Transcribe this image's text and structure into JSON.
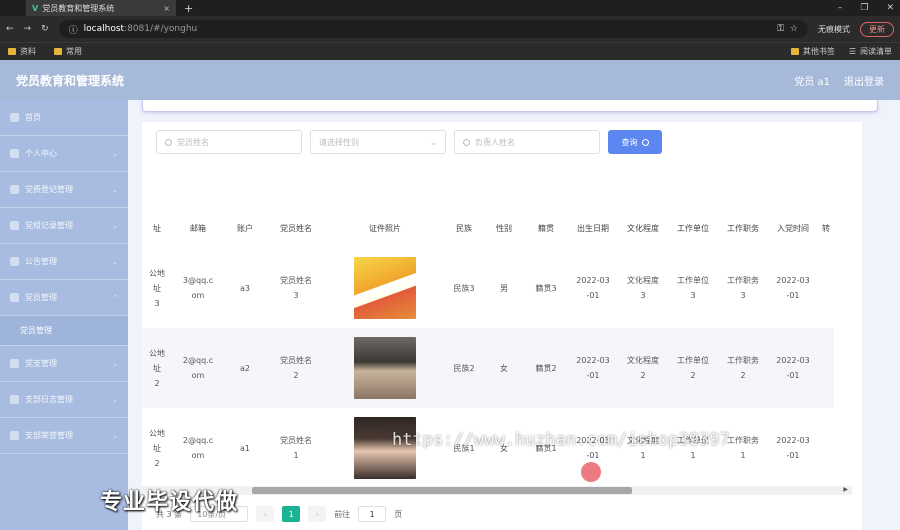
{
  "browser": {
    "tab_title": "党员教育和管理系统",
    "url_host": "localhost",
    "url_rest": ":8081/#/yonghu",
    "incognito_label": "无痕模式",
    "update_label": "更新",
    "bookmarks": [
      "资料",
      "常用"
    ],
    "bookmarks_right": [
      "其他书签",
      "阅读清单"
    ]
  },
  "app": {
    "title": "党员教育和管理系统",
    "user": "党员 a1",
    "logout": "退出登录"
  },
  "sidebar": {
    "items": [
      {
        "label": "首页",
        "icon": "home-icon"
      },
      {
        "label": "个人中心",
        "icon": "user-icon"
      },
      {
        "label": "党费登记管理",
        "icon": "send-icon"
      },
      {
        "label": "党组记录管理",
        "icon": "gear-icon"
      },
      {
        "label": "公告管理",
        "icon": "calendar-icon"
      },
      {
        "label": "党员管理",
        "icon": "card-icon"
      }
    ],
    "sub_item": "党员管理",
    "items_after": [
      {
        "label": "党支管理",
        "icon": "shield-icon"
      },
      {
        "label": "支部日志管理",
        "icon": "location-icon"
      },
      {
        "label": "支部荣誉管理",
        "icon": "chart-icon"
      }
    ]
  },
  "search": {
    "name_placeholder": "党员姓名",
    "gender_placeholder": "请选择性别",
    "leader_placeholder": "负责人姓名",
    "button": "查询"
  },
  "table": {
    "headers": [
      "址",
      "邮箱",
      "账户",
      "党员姓名",
      "证件照片",
      "民族",
      "性别",
      "籍贯",
      "出生日期",
      "文化程度",
      "工作单位",
      "工作职务",
      "入党时间",
      "转"
    ],
    "rows": [
      {
        "addr": [
          "公地址",
          "3"
        ],
        "email": [
          "3@qq.c",
          "om"
        ],
        "account": "a3",
        "name": [
          "党员姓名",
          "3"
        ],
        "photo": "p1",
        "ethnic": "民族3",
        "gender": "男",
        "origin": "籍贯3",
        "birth": [
          "2022-03",
          "-01"
        ],
        "edu": [
          "文化程度",
          "3"
        ],
        "unit": [
          "工作单位",
          "3"
        ],
        "job": [
          "工作职务",
          "3"
        ],
        "join": [
          "2022-03",
          "-01"
        ]
      },
      {
        "addr": [
          "公地址",
          "2"
        ],
        "email": [
          "2@qq.c",
          "om"
        ],
        "account": "a2",
        "name": [
          "党员姓名",
          "2"
        ],
        "photo": "p2",
        "ethnic": "民族2",
        "gender": "女",
        "origin": "籍贯2",
        "birth": [
          "2022-03",
          "-01"
        ],
        "edu": [
          "文化程度",
          "2"
        ],
        "unit": [
          "工作单位",
          "2"
        ],
        "job": [
          "工作职务",
          "2"
        ],
        "join": [
          "2022-03",
          "-01"
        ]
      },
      {
        "addr": [
          "公地址",
          "2"
        ],
        "email": [
          "2@qq.c",
          "om"
        ],
        "account": "a1",
        "name": [
          "党员姓名",
          "1"
        ],
        "photo": "p3",
        "ethnic": "民族1",
        "gender": "女",
        "origin": "籍贯1",
        "birth": [
          "2022-03",
          "-01"
        ],
        "edu": [
          "文化程度",
          "1"
        ],
        "unit": [
          "工作单位",
          "1"
        ],
        "job": [
          "工作职务",
          "1"
        ],
        "join": [
          "2022-03",
          "-01"
        ]
      }
    ]
  },
  "pager": {
    "total": "共 3 条",
    "page_size": "10条/页",
    "current": "1",
    "goto_label": "前往",
    "goto_value": "1",
    "page_unit": "页"
  },
  "watermarks": {
    "left": "专业毕设代做",
    "url": "https://www.huzhan.com/ishop39397"
  }
}
